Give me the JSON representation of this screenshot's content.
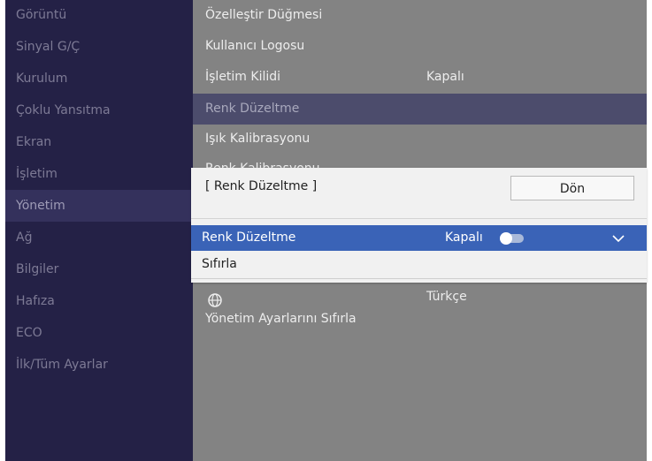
{
  "sidebar": {
    "items": [
      {
        "label": "Görüntü"
      },
      {
        "label": "Sinyal G/Ç"
      },
      {
        "label": "Kurulum"
      },
      {
        "label": "Çoklu Yansıtma"
      },
      {
        "label": "Ekran"
      },
      {
        "label": "İşletim"
      },
      {
        "label": "Yönetim"
      },
      {
        "label": "Ağ"
      },
      {
        "label": "Bilgiler"
      },
      {
        "label": "Hafıza"
      },
      {
        "label": "ECO"
      },
      {
        "label": "İlk/Tüm Ayarlar"
      }
    ],
    "active_index": 6
  },
  "main": {
    "items": [
      {
        "label": "Özelleştir Düğmesi"
      },
      {
        "label": "Kullanıcı Logosu"
      },
      {
        "label": "İşletim Kilidi",
        "value": "Kapalı"
      },
      {
        "label": "Renk Düzeltme"
      },
      {
        "label": "Işık Kalibrasyonu"
      },
      {
        "label": "Renk Kalibrasyonu"
      },
      {
        "label": "",
        "value": "Türkçe"
      },
      {
        "label": ""
      },
      {
        "label": "Yönetim Ayarlarını Sıfırla"
      }
    ]
  },
  "dialog": {
    "title": "[ Renk Düzeltme ]",
    "back_label": "Dön",
    "selected_row": {
      "label": "Renk Düzeltme",
      "value": "Kapalı",
      "toggle_on": false
    },
    "reset_label": "Sıfırla"
  },
  "colors": {
    "sidebar_bg": "#242146",
    "sidebar_active": "#34315c",
    "main_bg": "#838383",
    "main_highlight": "#4c4c6c",
    "selection_blue": "#3a63b7",
    "dialog_bg": "#f1f1f1"
  },
  "icons": {
    "language": "globe-icon",
    "dropdown": "chevron-down-icon",
    "toggle": "toggle-switch"
  }
}
